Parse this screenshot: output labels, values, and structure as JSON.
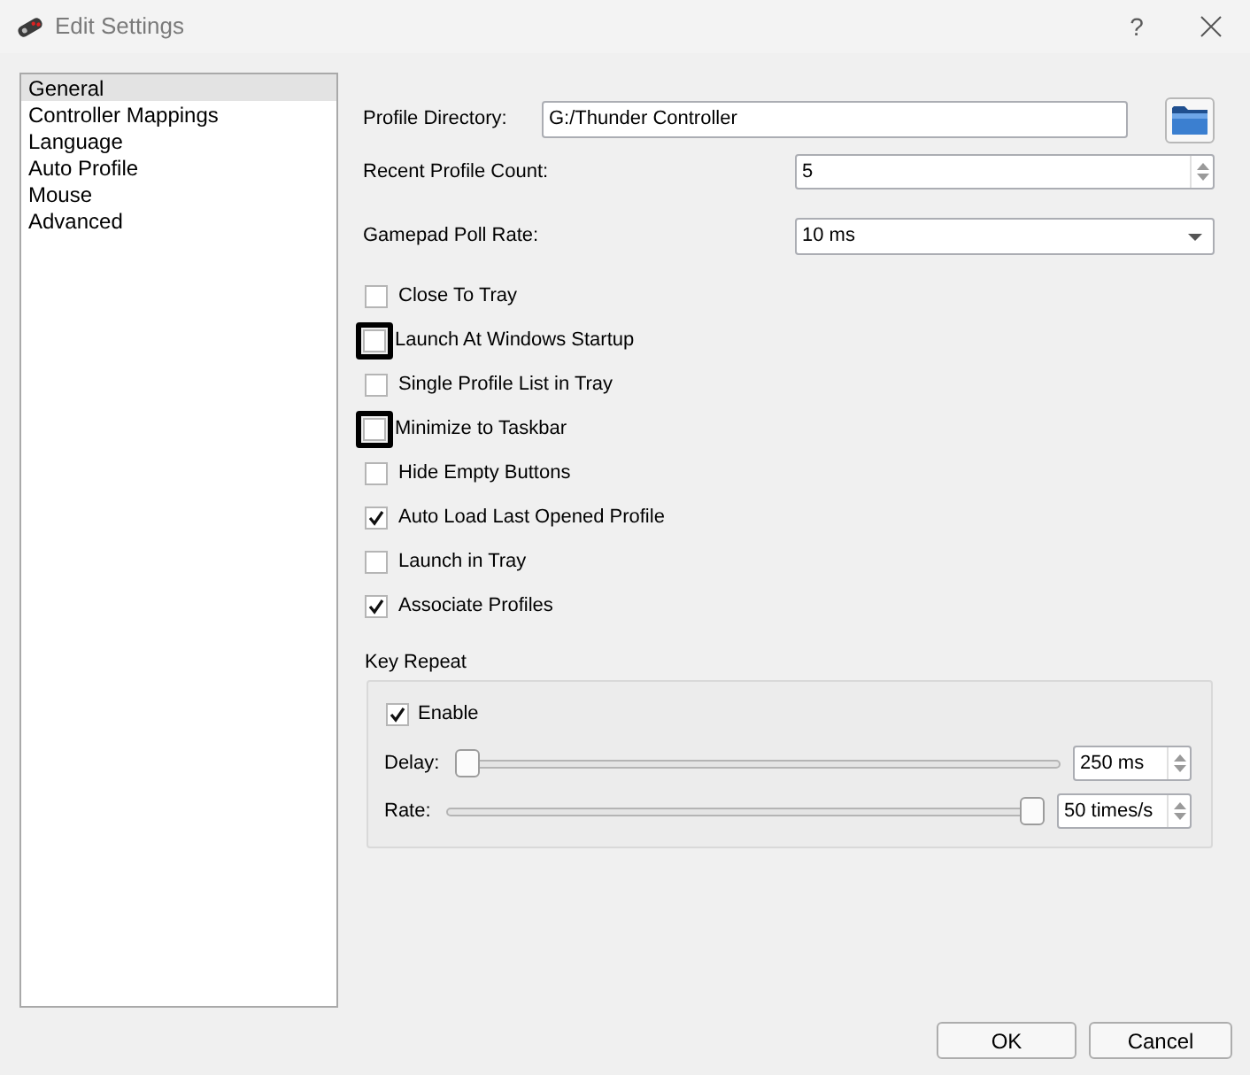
{
  "window": {
    "title": "Edit Settings",
    "help": "?"
  },
  "sidebar": {
    "items": [
      {
        "label": "General",
        "selected": true
      },
      {
        "label": "Controller Mappings",
        "selected": false
      },
      {
        "label": "Language",
        "selected": false
      },
      {
        "label": "Auto Profile",
        "selected": false
      },
      {
        "label": "Mouse",
        "selected": false
      },
      {
        "label": "Advanced",
        "selected": false
      }
    ]
  },
  "general": {
    "profile_directory": {
      "label": "Profile Directory:",
      "value": "G:/Thunder Controller"
    },
    "recent_profile_count": {
      "label": "Recent Profile Count:",
      "value": "5"
    },
    "gamepad_poll_rate": {
      "label": "Gamepad Poll Rate:",
      "value": "10 ms"
    },
    "options": [
      {
        "label": "Close To Tray",
        "checked": false,
        "focused": false
      },
      {
        "label": "Launch At Windows Startup",
        "checked": false,
        "focused": true
      },
      {
        "label": "Single Profile List in Tray",
        "checked": false,
        "focused": false
      },
      {
        "label": "Minimize to Taskbar",
        "checked": false,
        "focused": true
      },
      {
        "label": "Hide Empty Buttons",
        "checked": false,
        "focused": false
      },
      {
        "label": "Auto Load Last Opened Profile",
        "checked": true,
        "focused": false
      },
      {
        "label": "Launch in Tray",
        "checked": false,
        "focused": false
      },
      {
        "label": "Associate Profiles",
        "checked": true,
        "focused": false
      }
    ],
    "key_repeat": {
      "title": "Key Repeat",
      "enable": {
        "label": "Enable",
        "checked": true
      },
      "sliders": [
        {
          "label": "Delay:",
          "level": 0,
          "reading": "250 ms"
        },
        {
          "label": "Rate:",
          "level": 1,
          "reading": "50 times/s"
        }
      ]
    }
  },
  "buttons": [
    {
      "label": "OK"
    },
    {
      "label": "Cancel"
    }
  ]
}
